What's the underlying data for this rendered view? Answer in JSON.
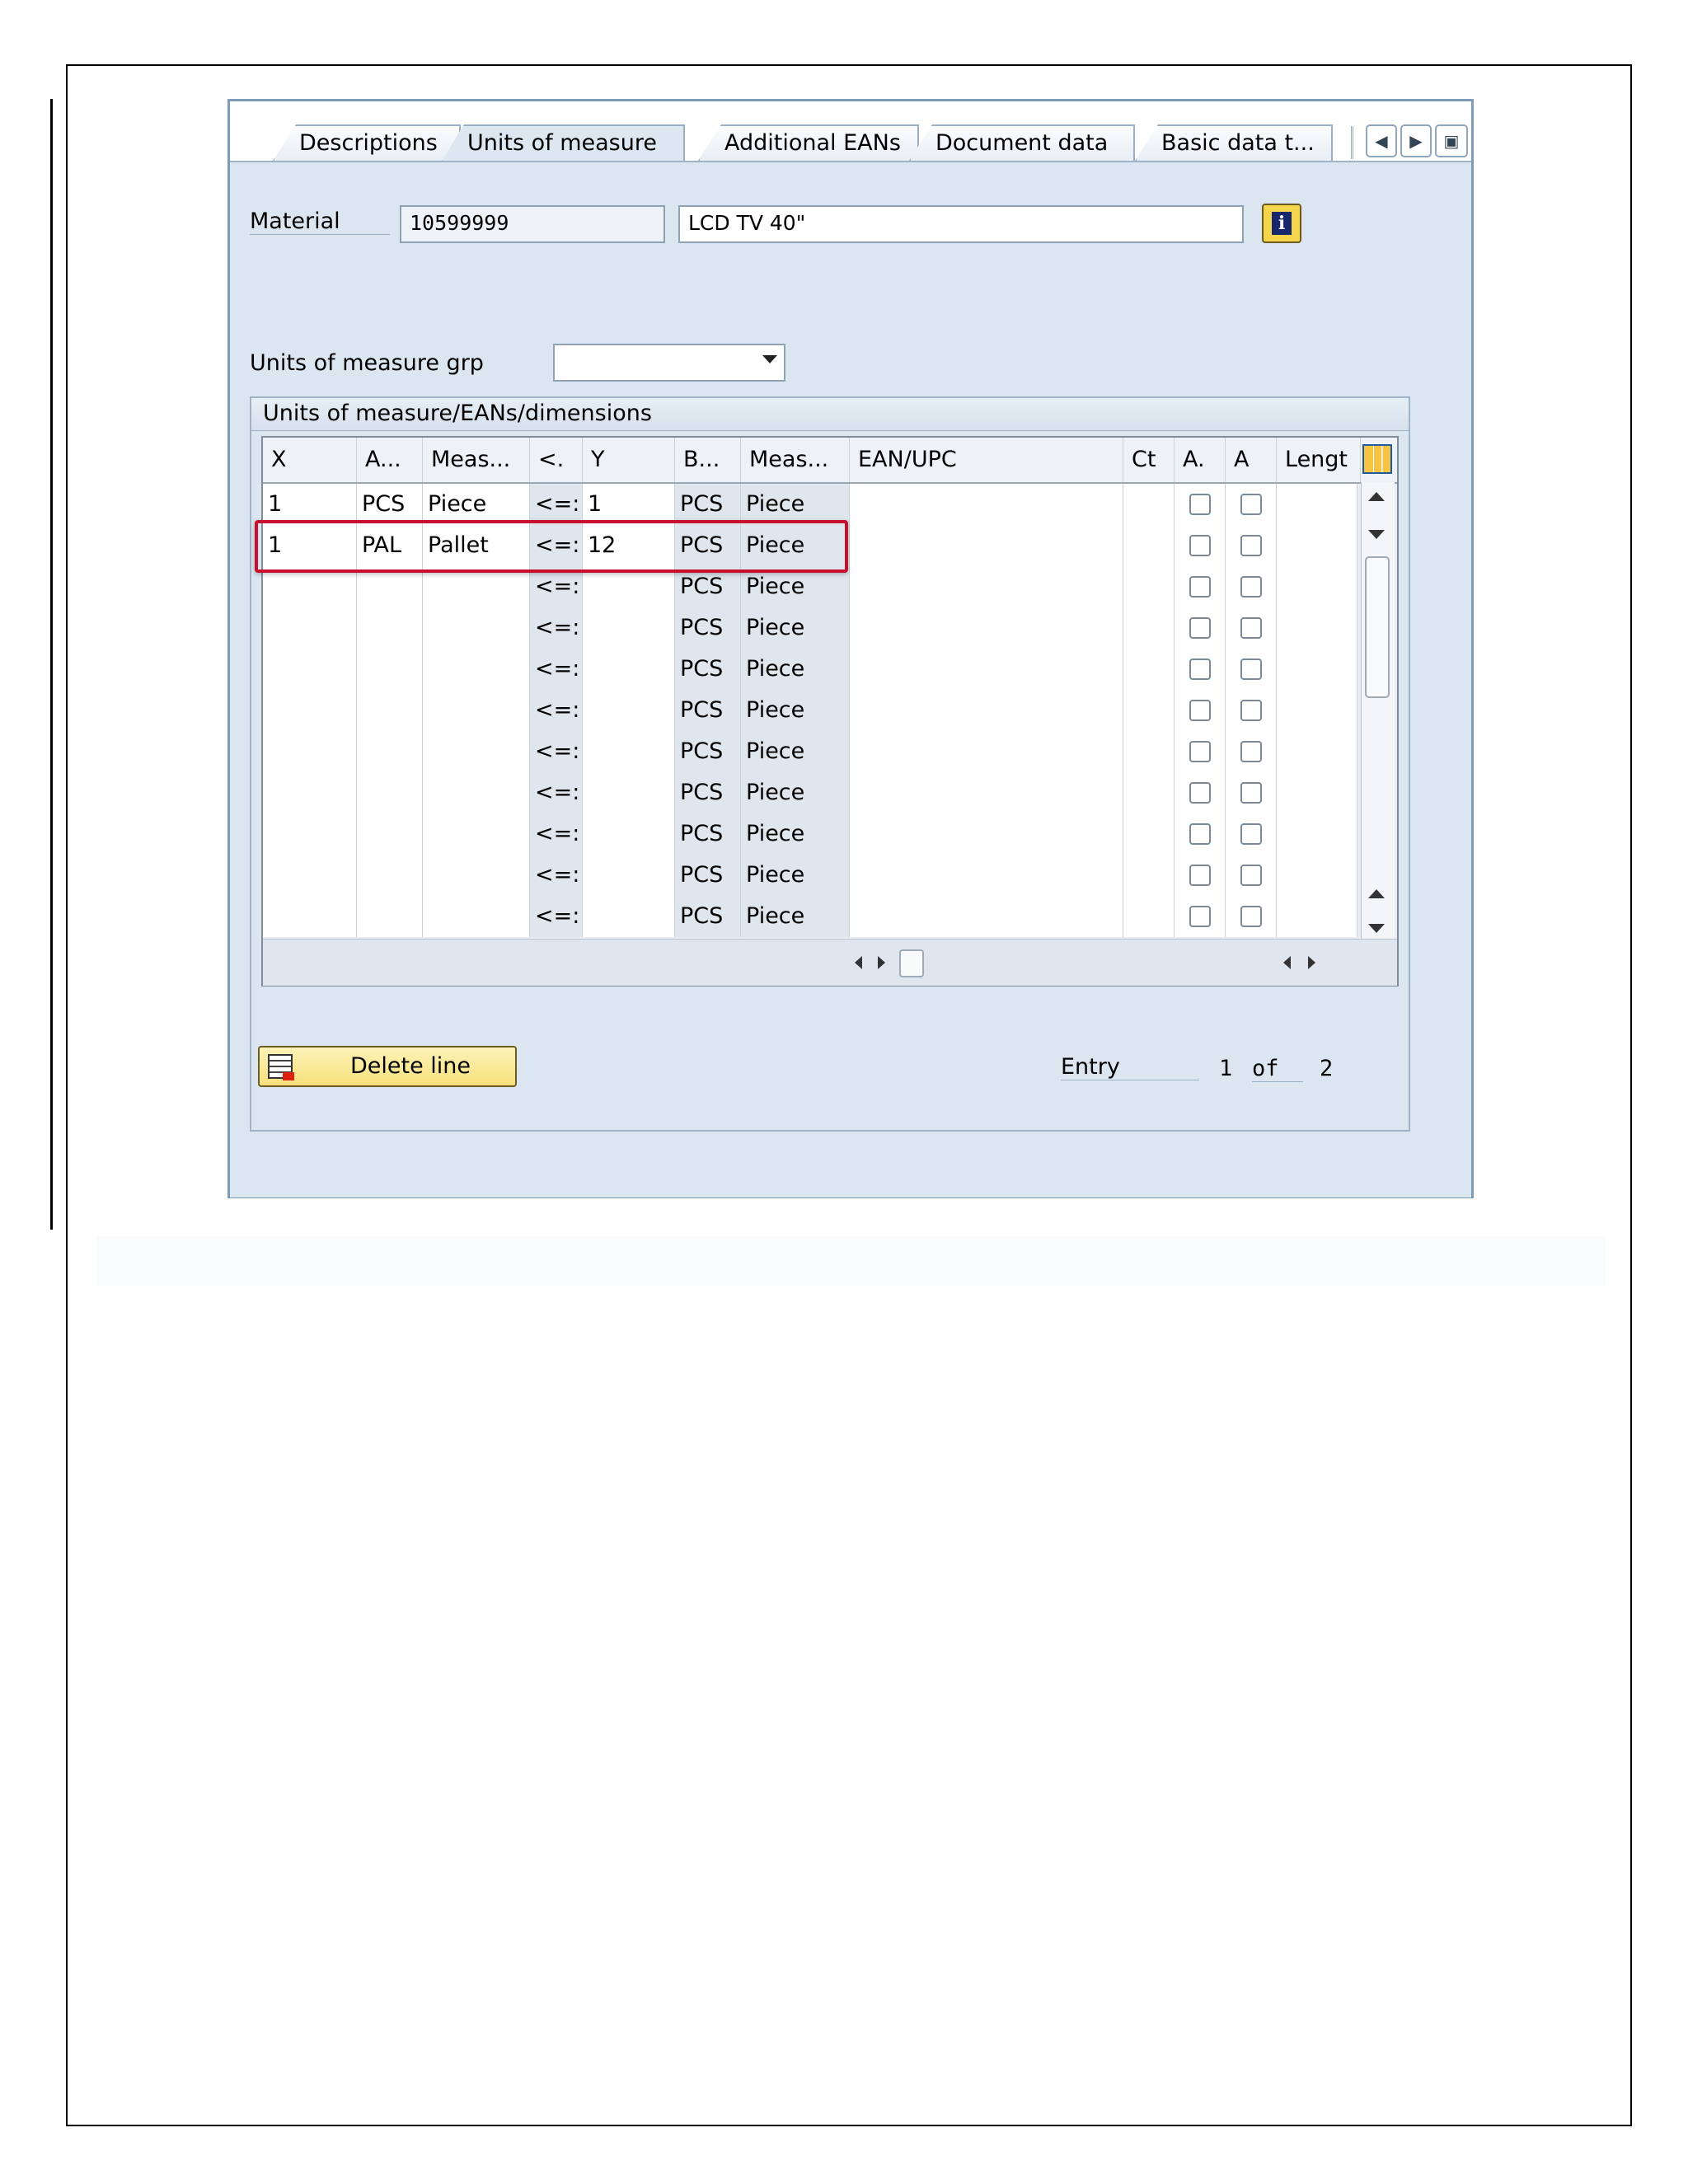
{
  "tabs": [
    {
      "label": "Descriptions",
      "active": false
    },
    {
      "label": "Units of measure",
      "active": true
    },
    {
      "label": "Additional EANs",
      "active": false
    },
    {
      "label": "Document data",
      "active": false
    },
    {
      "label": "Basic data t...",
      "active": false
    }
  ],
  "material": {
    "label": "Material",
    "number": "10599999",
    "description": "LCD TV 40\""
  },
  "uom_group": {
    "label": "Units of measure grp",
    "value": ""
  },
  "group_box": {
    "title": "Units of measure/EANs/dimensions"
  },
  "table": {
    "columns": [
      "X",
      "A...",
      "Meas...",
      "<.",
      "Y",
      "B...",
      "Meas...",
      "EAN/UPC",
      "Ct",
      "A.",
      "A",
      "Lengt"
    ],
    "rows": [
      {
        "x": "1",
        "aun": "PCS",
        "meas": "Piece",
        "op": "<=:",
        "y": "1",
        "bun": "PCS",
        "meas2": "Piece"
      },
      {
        "x": "1",
        "aun": "PAL",
        "meas": "Pallet",
        "op": "<=:",
        "y": "12",
        "bun": "PCS",
        "meas2": "Piece"
      },
      {
        "x": "",
        "aun": "",
        "meas": "",
        "op": "<=:",
        "y": "",
        "bun": "PCS",
        "meas2": "Piece"
      },
      {
        "x": "",
        "aun": "",
        "meas": "",
        "op": "<=:",
        "y": "",
        "bun": "PCS",
        "meas2": "Piece"
      },
      {
        "x": "",
        "aun": "",
        "meas": "",
        "op": "<=:",
        "y": "",
        "bun": "PCS",
        "meas2": "Piece"
      },
      {
        "x": "",
        "aun": "",
        "meas": "",
        "op": "<=:",
        "y": "",
        "bun": "PCS",
        "meas2": "Piece"
      },
      {
        "x": "",
        "aun": "",
        "meas": "",
        "op": "<=:",
        "y": "",
        "bun": "PCS",
        "meas2": "Piece"
      },
      {
        "x": "",
        "aun": "",
        "meas": "",
        "op": "<=:",
        "y": "",
        "bun": "PCS",
        "meas2": "Piece"
      },
      {
        "x": "",
        "aun": "",
        "meas": "",
        "op": "<=:",
        "y": "",
        "bun": "PCS",
        "meas2": "Piece"
      },
      {
        "x": "",
        "aun": "",
        "meas": "",
        "op": "<=:",
        "y": "",
        "bun": "PCS",
        "meas2": "Piece"
      },
      {
        "x": "",
        "aun": "",
        "meas": "",
        "op": "<=:",
        "y": "",
        "bun": "PCS",
        "meas2": "Piece"
      }
    ],
    "highlighted_row": 1
  },
  "delete_button": {
    "label": "Delete line"
  },
  "entry": {
    "label": "Entry",
    "current": "1",
    "of_label": "of",
    "total": "2"
  },
  "colors": {
    "highlight": "#c8102e",
    "panel": "#dce6f1",
    "button": "#f7e07b"
  }
}
